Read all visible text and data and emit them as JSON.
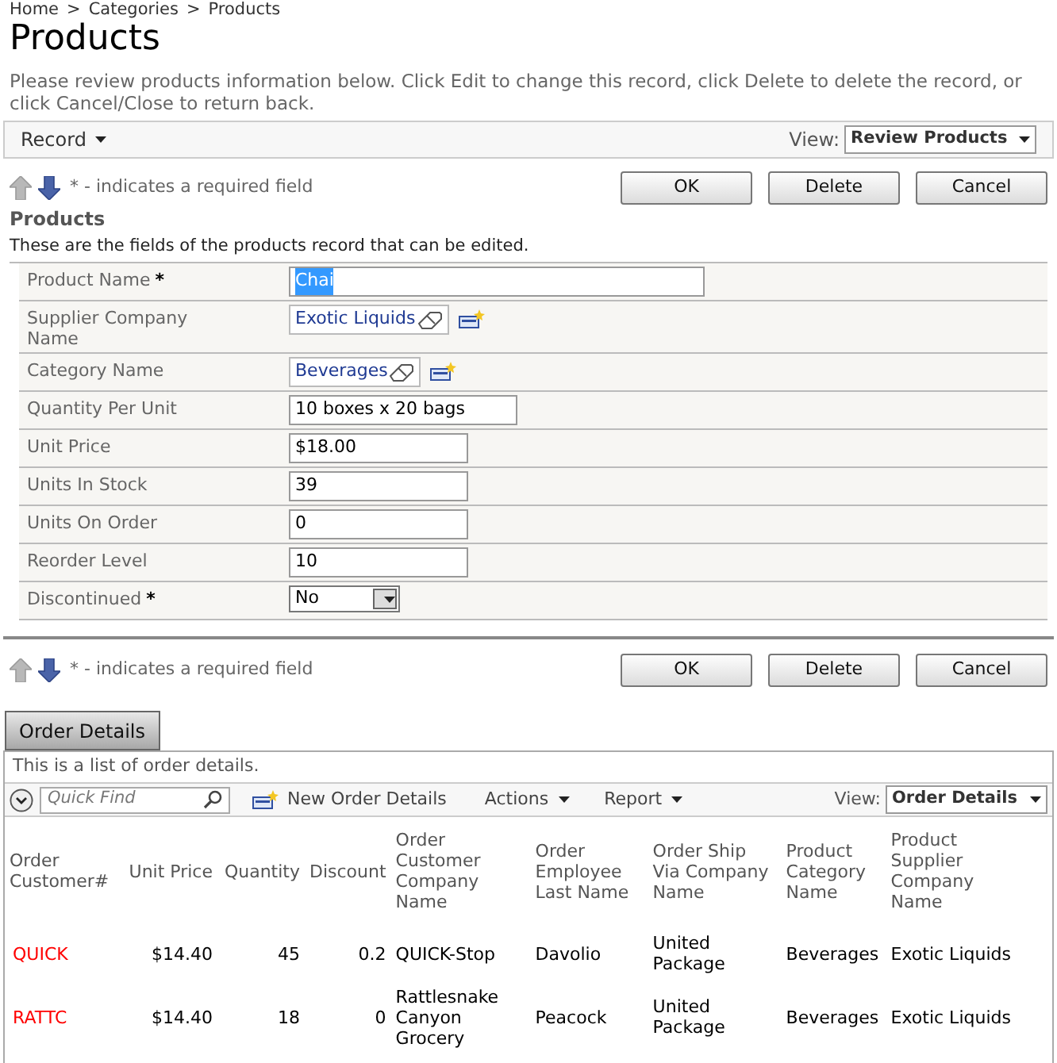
{
  "breadcrumb": [
    "Home",
    "Categories",
    "Products"
  ],
  "breadcrumb_separator": ">",
  "required_mark": "*",
  "title": "Products",
  "description": "Please review products information below. Click Edit to change this record, click Delete to delete the record, or click Cancel/Close to return back.",
  "toolbar": {
    "menu": "Record",
    "view_label": "View:",
    "view": "Review Products"
  },
  "action_bars": [
    {
      "up_enabled": false,
      "down_enabled": true,
      "required_note": "* - indicates a required field",
      "buttons": [
        "OK",
        "Delete",
        "Cancel"
      ]
    },
    {
      "up_enabled": false,
      "down_enabled": true,
      "required_note": "* - indicates a required field",
      "buttons": [
        "OK",
        "Delete",
        "Cancel"
      ]
    }
  ],
  "section": {
    "title": "Products",
    "subtitle": "These are the fields of the products record that can be edited."
  },
  "fields": [
    {
      "label": "Product Name",
      "required": true,
      "kind": "text",
      "value": "Chai",
      "value_selected": true
    },
    {
      "label": "Supplier Company Name",
      "required": false,
      "kind": "lookup",
      "value": "Exotic Liquids",
      "value_selected": false
    },
    {
      "label": "Category Name",
      "required": false,
      "kind": "lookup",
      "value": "Beverages",
      "value_selected": false
    },
    {
      "label": "Quantity Per Unit",
      "required": false,
      "kind": "text",
      "value": "10 boxes x 20 bags",
      "value_selected": false
    },
    {
      "label": "Unit Price",
      "required": false,
      "kind": "text",
      "value": "$18.00",
      "value_selected": false
    },
    {
      "label": "Units In Stock",
      "required": false,
      "kind": "text",
      "value": "39",
      "value_selected": false
    },
    {
      "label": "Units On Order",
      "required": false,
      "kind": "text",
      "value": "0",
      "value_selected": false
    },
    {
      "label": "Reorder Level",
      "required": false,
      "kind": "text",
      "value": "10",
      "value_selected": false
    },
    {
      "label": "Discontinued",
      "required": true,
      "kind": "select",
      "value": "No",
      "value_selected": false
    }
  ],
  "tabs": [
    {
      "label": "Order Details",
      "selected": true
    }
  ],
  "details": {
    "description": "This is a list of order details.",
    "quick_find_placeholder": "Quick Find",
    "new_button": "New Order Details",
    "actions_menu": "Actions",
    "report_menu": "Report",
    "view_label": "View:",
    "view": "Order Details",
    "columns": [
      "Order Customer#",
      "Unit Price",
      "Quantity",
      "Discount",
      "Order Customer Company Name",
      "Order Employee Last Name",
      "Order Ship Via Company Name",
      "Product Category Name",
      "Product Supplier Company Name"
    ],
    "rows": [
      [
        "QUICK",
        "$14.40",
        "45",
        "0.2",
        "QUICK-Stop",
        "Davolio",
        "United Package",
        "Beverages",
        "Exotic Liquids"
      ],
      [
        "RATTC",
        "$14.40",
        "18",
        "0",
        "Rattlesnake Canyon Grocery",
        "Peacock",
        "United Package",
        "Beverages",
        "Exotic Liquids"
      ]
    ]
  }
}
